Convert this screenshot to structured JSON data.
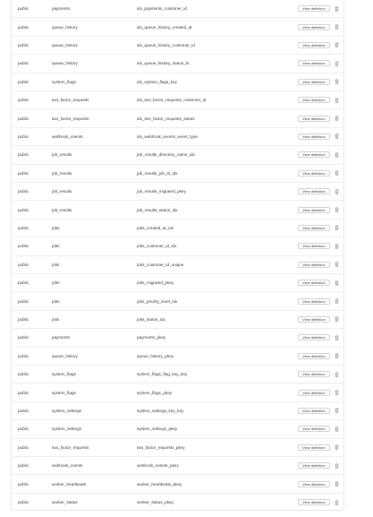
{
  "indexes": {
    "action_label": "View definition",
    "delete_icon": "trash-icon",
    "rows": [
      {
        "schema": "public",
        "table": "payments",
        "index": "idx_payments_customer_id"
      },
      {
        "schema": "public",
        "table": "queue_history",
        "index": "idx_queue_history_created_at"
      },
      {
        "schema": "public",
        "table": "queue_history",
        "index": "idx_queue_history_customer_id"
      },
      {
        "schema": "public",
        "table": "queue_history",
        "index": "idx_queue_history_status_ts"
      },
      {
        "schema": "public",
        "table": "system_flags",
        "index": "idx_system_flags_key"
      },
      {
        "schema": "public",
        "table": "two_factor_requests",
        "index": "idx_two_factor_requests_customer_id"
      },
      {
        "schema": "public",
        "table": "two_factor_requests",
        "index": "idx_two_factor_requests_status"
      },
      {
        "schema": "public",
        "table": "webhook_events",
        "index": "idx_webhook_events_event_type"
      },
      {
        "schema": "public",
        "table": "job_results",
        "index": "job_results_directory_name_idx"
      },
      {
        "schema": "public",
        "table": "job_results",
        "index": "job_results_job_id_idx"
      },
      {
        "schema": "public",
        "table": "job_results",
        "index": "job_results_migrated_pkey"
      },
      {
        "schema": "public",
        "table": "job_results",
        "index": "job_results_status_idx"
      },
      {
        "schema": "public",
        "table": "jobs",
        "index": "jobs_created_at_idx"
      },
      {
        "schema": "public",
        "table": "jobs",
        "index": "jobs_customer_id_idx"
      },
      {
        "schema": "public",
        "table": "jobs",
        "index": "jobs_customer_id_unique"
      },
      {
        "schema": "public",
        "table": "jobs",
        "index": "jobs_migrated_pkey"
      },
      {
        "schema": "public",
        "table": "jobs",
        "index": "jobs_priority_level_idx"
      },
      {
        "schema": "public",
        "table": "jobs",
        "index": "jobs_status_idx"
      },
      {
        "schema": "public",
        "table": "payments",
        "index": "payments_pkey"
      },
      {
        "schema": "public",
        "table": "queue_history",
        "index": "queue_history_pkey"
      },
      {
        "schema": "public",
        "table": "system_flags",
        "index": "system_flags_flag_key_key"
      },
      {
        "schema": "public",
        "table": "system_flags",
        "index": "system_flags_pkey"
      },
      {
        "schema": "public",
        "table": "system_settings",
        "index": "system_settings_key_key"
      },
      {
        "schema": "public",
        "table": "system_settings",
        "index": "system_settings_pkey"
      },
      {
        "schema": "public",
        "table": "two_factor_requests",
        "index": "two_factor_requests_pkey"
      },
      {
        "schema": "public",
        "table": "webhook_events",
        "index": "webhook_events_pkey"
      },
      {
        "schema": "public",
        "table": "worker_heartbeats",
        "index": "worker_heartbeats_pkey"
      },
      {
        "schema": "public",
        "table": "worker_status",
        "index": "worker_status_pkey"
      }
    ]
  }
}
